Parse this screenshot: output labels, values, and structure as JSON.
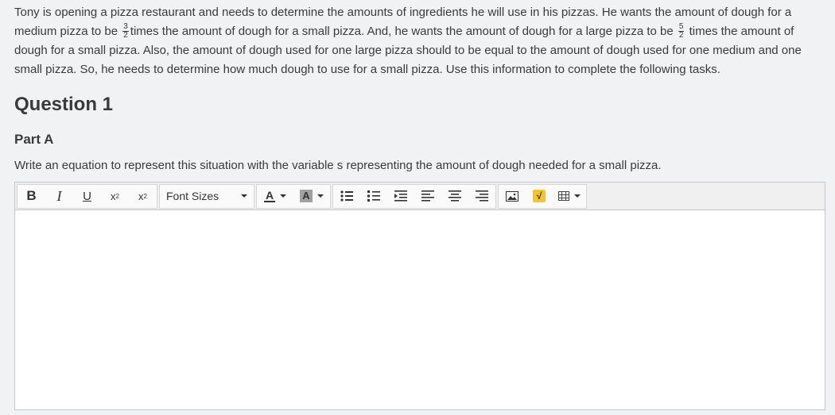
{
  "passage": {
    "part1": "Tony is opening a pizza restaurant and needs to determine the amounts of ingredients he will use in his pizzas. He wants the amount of dough for a medium pizza to be ",
    "frac1_num": "3",
    "frac1_den": "2",
    "part2": "times the amount of dough for a small pizza. And, he wants the amount of dough for a large pizza to be ",
    "frac2_num": "5",
    "frac2_den": "2",
    "part3": " times the amount of dough for a small pizza. Also, the amount of dough used for one large pizza should to be equal to the amount of dough used for one medium and one small pizza. So, he needs to determine how much dough to use for a small pizza. Use this information to complete the following tasks."
  },
  "question": {
    "title": "Question 1",
    "part": "Part A",
    "prompt": "Write an equation to represent this situation with the variable s representing the amount of dough needed for a small pizza."
  },
  "toolbar": {
    "bold": "B",
    "italic": "I",
    "underline": "U",
    "superscript": "x",
    "superscript_mark": "2",
    "subscript": "x",
    "subscript_mark": "2",
    "font_sizes": "Font Sizes",
    "text_color": "A",
    "bg_color": "A",
    "sqrt": "√"
  },
  "icons": [
    "bullet-list-icon",
    "numbered-list-icon",
    "indent-icon",
    "align-left-icon",
    "align-center-icon",
    "align-right-icon",
    "image-icon",
    "sqrt-icon",
    "table-icon"
  ]
}
